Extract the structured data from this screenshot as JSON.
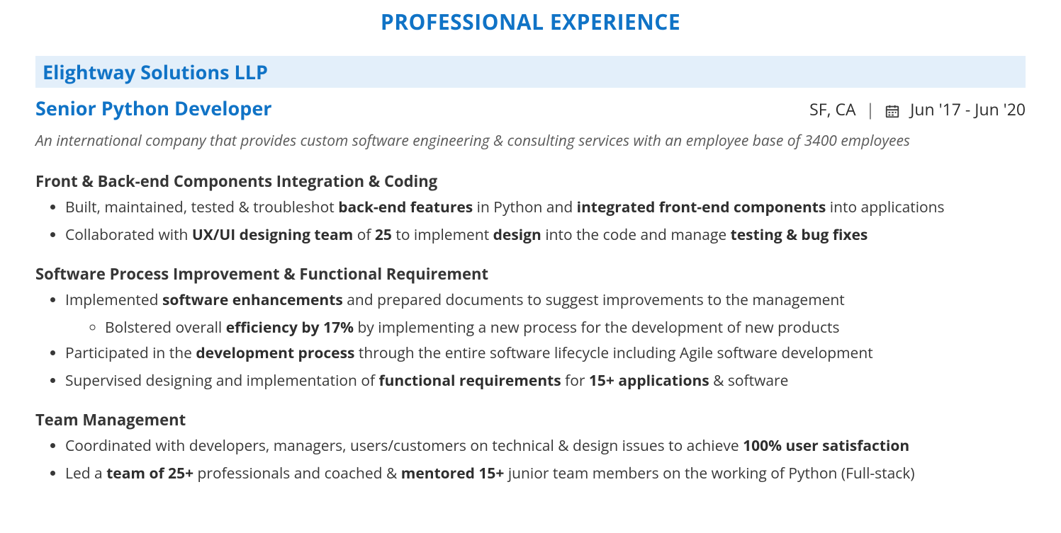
{
  "section_title": "PROFESSIONAL EXPERIENCE",
  "company": "Elightway Solutions LLP",
  "role": "Senior Python Developer",
  "location": "SF, CA",
  "dates": "Jun '17 - Jun '20",
  "summary": "An international company that provides custom software engineering & consulting services with an employee base of 3400 employees",
  "blocks": [
    {
      "heading": "Front & Back-end Components Integration & Coding",
      "bullets": [
        {
          "html": "Built, maintained, tested & troubleshot <b>back-end features</b> in Python and <b>integrated front-end components</b> into applications"
        },
        {
          "html": "Collaborated with <b>UX/UI designing team</b> of <b>25</b> to implement <b>design</b> into the code and manage <b>testing & bug fixes</b>"
        }
      ]
    },
    {
      "heading": "Software Process Improvement & Functional Requirement",
      "bullets": [
        {
          "html": "Implemented <b>software enhancements</b> and prepared documents to suggest improvements to the management",
          "sub": [
            {
              "html": "Bolstered overall <b>efficiency by 17%</b> by implementing a new process for the development of new products"
            }
          ]
        },
        {
          "html": "Participated in the <b>development process</b> through the entire software lifecycle including Agile software development"
        },
        {
          "html": "Supervised designing and implementation of <b>functional requirements</b> for <b>15+ applications</b> & software"
        }
      ]
    },
    {
      "heading": "Team Management",
      "bullets": [
        {
          "html": "Coordinated with developers, managers, users/customers on technical & design issues to achieve <b>100% user satisfaction</b>"
        },
        {
          "html": "Led a <b>team of 25+</b> professionals and coached & <b>mentored 15+</b> junior team members on the working of Python (Full-stack)"
        }
      ]
    }
  ]
}
